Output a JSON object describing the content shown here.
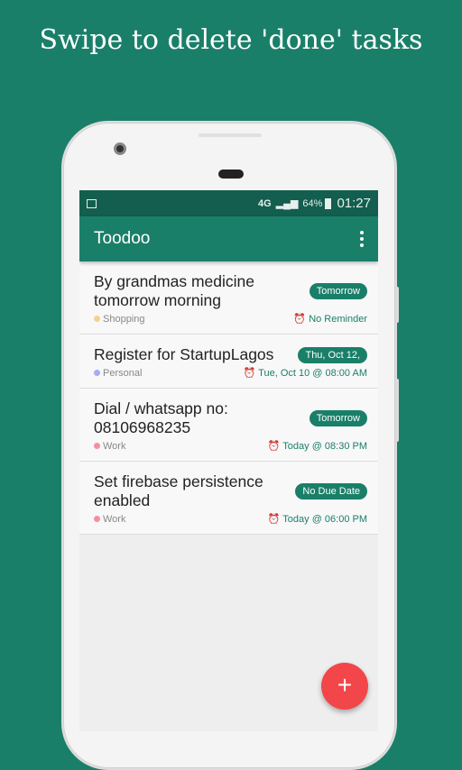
{
  "headline": "Swipe to delete 'done' tasks",
  "status": {
    "network": "4G",
    "battery": "64%",
    "time": "01:27"
  },
  "toolbar": {
    "title": "Toodoo",
    "menu_icon": "more-vert-icon"
  },
  "tasks": [
    {
      "title": "By grandmas medicine tomorrow morning",
      "due": "Tomorrow",
      "category": "Shopping",
      "category_color": "#f9cf8f",
      "reminder": "No Reminder"
    },
    {
      "title": "Register for StartupLagos",
      "due": "Thu, Oct 12,",
      "category": "Personal",
      "category_color": "#a7aaf5",
      "reminder": "Tue, Oct 10 @ 08:00 AM"
    },
    {
      "title": "Dial / whatsapp no: 08106968235",
      "due": "Tomorrow",
      "category": "Work",
      "category_color": "#f48fa0",
      "reminder": "Today @ 08:30 PM"
    },
    {
      "title": "Set firebase persistence enabled",
      "due": "No Due Date",
      "category": "Work",
      "category_color": "#f48fa0",
      "reminder": "Today @ 06:00 PM"
    }
  ],
  "fab": {
    "label": "+",
    "color": "#f2464a"
  },
  "colors": {
    "primary": "#1a7f69",
    "primary_dark": "#135e4e"
  }
}
